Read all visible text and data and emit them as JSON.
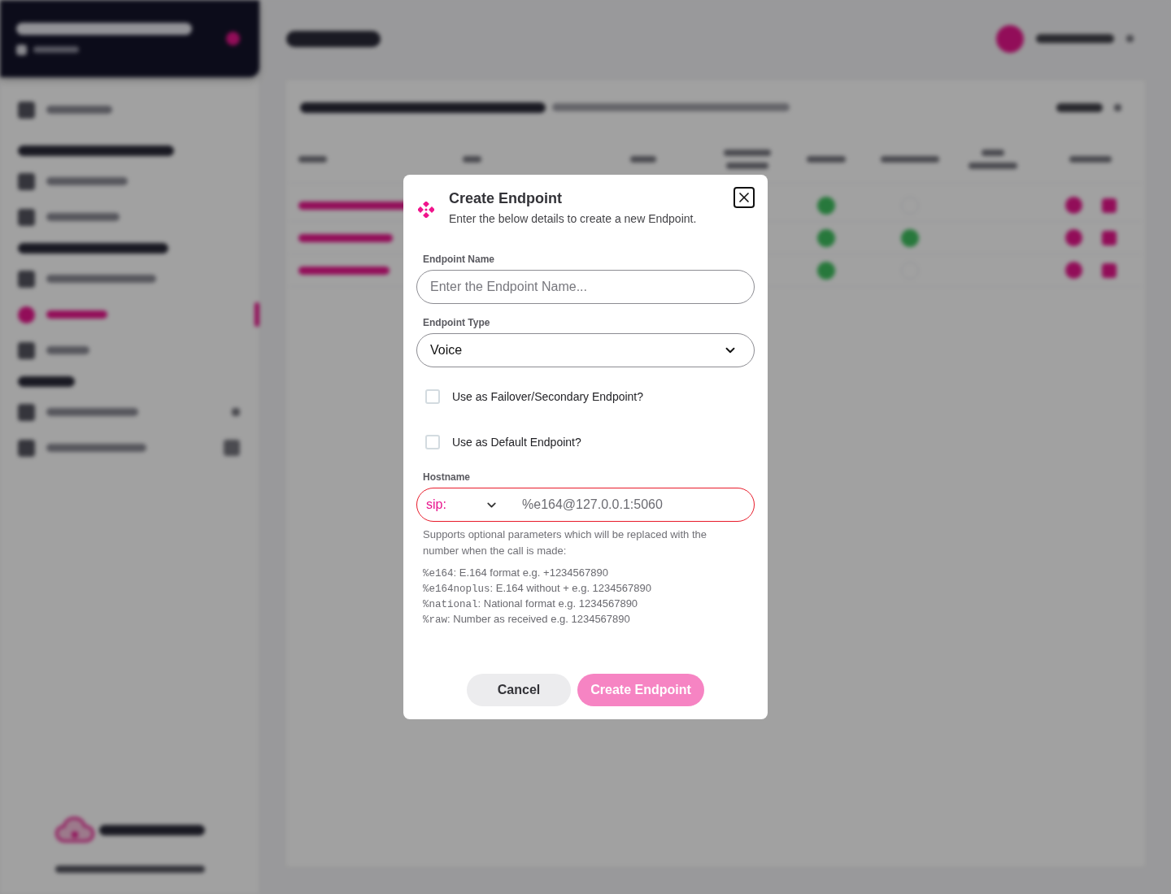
{
  "dialog": {
    "title": "Create Endpoint",
    "subtitle": "Enter the below details to create a new Endpoint.",
    "fields": [
      {
        "kind": "text",
        "label": "Endpoint Name",
        "placeholder": "Enter the Endpoint Name..."
      },
      {
        "kind": "select",
        "label": "Endpoint Type",
        "value": "Voice"
      },
      {
        "kind": "checkbox",
        "label": "Use as Failover/Secondary Endpoint?",
        "checked": false
      },
      {
        "kind": "checkbox",
        "label": "Use as Default Endpoint?",
        "checked": false
      },
      {
        "kind": "hostname",
        "label": "Hostname",
        "scheme": "sip:",
        "placeholder": "%e164@127.0.0.1:5060",
        "error": true,
        "help": "Supports optional parameters which will be replaced with the number when the call is made:",
        "parameters": [
          {
            "code": "%e164",
            "text": ": E.164 format e.g. +1234567890"
          },
          {
            "code": "%e164noplus",
            "text": ": E.164 without + e.g. 1234567890"
          },
          {
            "code": "%national",
            "text": ": National format e.g. 1234567890"
          },
          {
            "code": "%raw",
            "text": ": Number as received e.g. 1234567890"
          }
        ]
      }
    ],
    "buttons": [
      {
        "kind": "secondary",
        "label": "Cancel",
        "disabled": false
      },
      {
        "kind": "primary",
        "label": "Create Endpoint",
        "disabled": true
      }
    ]
  }
}
